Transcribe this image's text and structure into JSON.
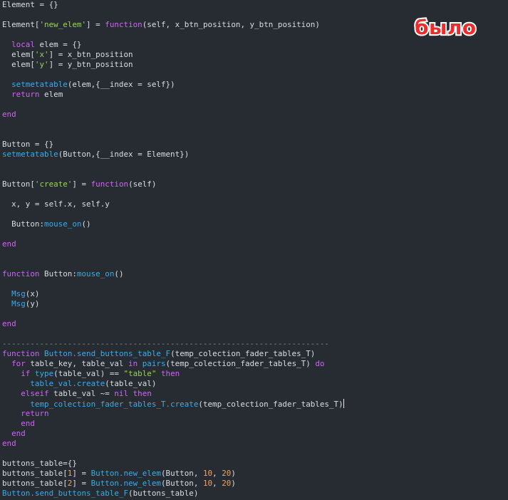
{
  "badge": "было",
  "colors": {
    "background": "#272c33",
    "plain": "#d9dde3",
    "keyword": "#cc66ee",
    "function": "#3fa9e4",
    "string": "#9bd05c",
    "number": "#f2a35a",
    "badge_text": "#ef2b2b"
  },
  "code_lines": [
    [
      [
        "p",
        "Element = {}"
      ]
    ],
    [],
    [
      [
        "p",
        "Element["
      ],
      [
        "s",
        "'new_elem'"
      ],
      [
        "p",
        "] = "
      ],
      [
        "k",
        "function"
      ],
      [
        "p",
        "(self, x_btn_position, y_btn_position)"
      ]
    ],
    [],
    [
      [
        "p",
        "  "
      ],
      [
        "k",
        "local"
      ],
      [
        "p",
        " elem = {}"
      ]
    ],
    [
      [
        "p",
        "  elem["
      ],
      [
        "s",
        "'x'"
      ],
      [
        "p",
        "] = x_btn_position"
      ]
    ],
    [
      [
        "p",
        "  elem["
      ],
      [
        "s",
        "'y'"
      ],
      [
        "p",
        "] = y_btn_position"
      ]
    ],
    [],
    [
      [
        "p",
        "  "
      ],
      [
        "f",
        "setmetatable"
      ],
      [
        "p",
        "(elem,{__index = self})"
      ]
    ],
    [
      [
        "p",
        "  "
      ],
      [
        "k",
        "return"
      ],
      [
        "p",
        " elem"
      ]
    ],
    [],
    [
      [
        "k",
        "end"
      ]
    ],
    [],
    [],
    [
      [
        "p",
        "Button = {}"
      ]
    ],
    [
      [
        "f",
        "setmetatable"
      ],
      [
        "p",
        "(Button,{__index = Element})"
      ]
    ],
    [],
    [],
    [
      [
        "p",
        "Button["
      ],
      [
        "s",
        "'create'"
      ],
      [
        "p",
        "] = "
      ],
      [
        "k",
        "function"
      ],
      [
        "p",
        "(self)"
      ]
    ],
    [],
    [
      [
        "p",
        "  x, y = self.x, self.y"
      ]
    ],
    [],
    [
      [
        "p",
        "  Button:"
      ],
      [
        "f",
        "mouse_on"
      ],
      [
        "p",
        "()"
      ]
    ],
    [],
    [
      [
        "k",
        "end"
      ]
    ],
    [],
    [],
    [
      [
        "k",
        "function"
      ],
      [
        "p",
        " Button:"
      ],
      [
        "f",
        "mouse_on"
      ],
      [
        "p",
        "()"
      ]
    ],
    [],
    [
      [
        "p",
        "  "
      ],
      [
        "f",
        "Msg"
      ],
      [
        "p",
        "(x)"
      ]
    ],
    [
      [
        "p",
        "  "
      ],
      [
        "f",
        "Msg"
      ],
      [
        "p",
        "(y)"
      ]
    ],
    [],
    [
      [
        "k",
        "end"
      ]
    ],
    [],
    [
      [
        "d",
        "----------------------------------------------------------------------"
      ]
    ],
    [
      [
        "k",
        "function"
      ],
      [
        "p",
        " "
      ],
      [
        "f",
        "Button.send_buttons_table_F"
      ],
      [
        "p",
        "(temp_colection_fader_tables_T)"
      ]
    ],
    [
      [
        "p",
        "  "
      ],
      [
        "k",
        "for"
      ],
      [
        "p",
        " table_key, table_val "
      ],
      [
        "k",
        "in"
      ],
      [
        "p",
        " "
      ],
      [
        "f",
        "pairs"
      ],
      [
        "p",
        "(temp_colection_fader_tables_T) "
      ],
      [
        "k",
        "do"
      ]
    ],
    [
      [
        "p",
        "    "
      ],
      [
        "k",
        "if"
      ],
      [
        "p",
        " "
      ],
      [
        "f",
        "type"
      ],
      [
        "p",
        "(table_val) == "
      ],
      [
        "s",
        "\"table\""
      ],
      [
        "p",
        " "
      ],
      [
        "k",
        "then"
      ]
    ],
    [
      [
        "p",
        "      "
      ],
      [
        "f",
        "table_val.create"
      ],
      [
        "p",
        "(table_val)"
      ]
    ],
    [
      [
        "p",
        "    "
      ],
      [
        "k",
        "elseif"
      ],
      [
        "p",
        " table_val ~= "
      ],
      [
        "k",
        "nil"
      ],
      [
        "p",
        " "
      ],
      [
        "k",
        "then"
      ]
    ],
    [
      [
        "p",
        "      "
      ],
      [
        "f",
        "temp_colection_fader_tables_T.create"
      ],
      [
        "p",
        "(temp_colection_fader_tables_T)"
      ],
      [
        "caret",
        ""
      ]
    ],
    [
      [
        "p",
        "    "
      ],
      [
        "k",
        "return"
      ]
    ],
    [
      [
        "p",
        "    "
      ],
      [
        "k",
        "end"
      ]
    ],
    [
      [
        "p",
        "  "
      ],
      [
        "k",
        "end"
      ]
    ],
    [
      [
        "k",
        "end"
      ]
    ],
    [],
    [
      [
        "p",
        "buttons_table={}"
      ]
    ],
    [
      [
        "p",
        "buttons_table["
      ],
      [
        "n",
        "1"
      ],
      [
        "p",
        "] = "
      ],
      [
        "f",
        "Button.new_elem"
      ],
      [
        "p",
        "(Button, "
      ],
      [
        "n",
        "10"
      ],
      [
        "p",
        ", "
      ],
      [
        "n",
        "20"
      ],
      [
        "p",
        ")"
      ]
    ],
    [
      [
        "p",
        "buttons_table["
      ],
      [
        "n",
        "2"
      ],
      [
        "p",
        "] = "
      ],
      [
        "f",
        "Button.new_elem"
      ],
      [
        "p",
        "(Button, "
      ],
      [
        "n",
        "10"
      ],
      [
        "p",
        ", "
      ],
      [
        "n",
        "20"
      ],
      [
        "p",
        ")"
      ]
    ],
    [
      [
        "f",
        "Button.send_buttons_table_F"
      ],
      [
        "p",
        "(buttons_table)"
      ]
    ]
  ]
}
